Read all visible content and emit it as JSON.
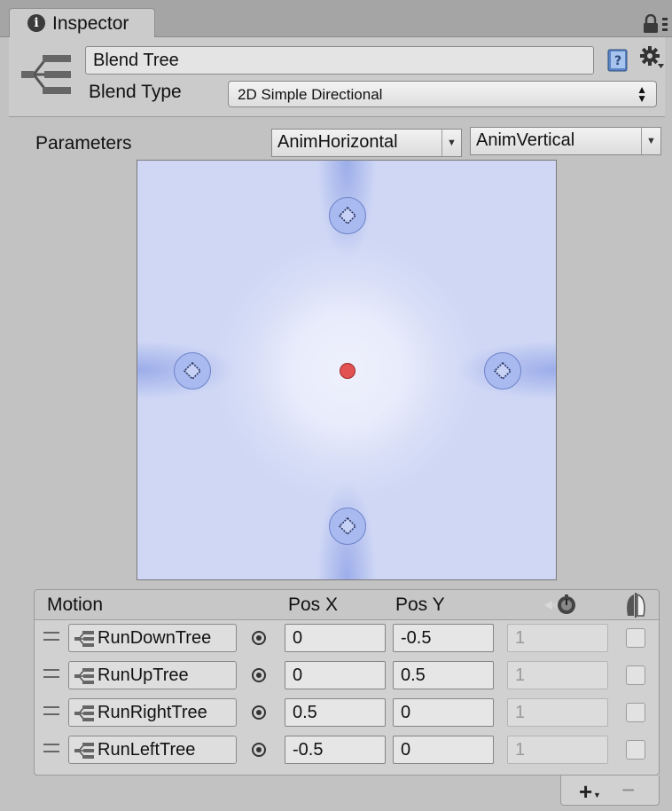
{
  "tab": {
    "label": "Inspector",
    "info_glyph": "i"
  },
  "header": {
    "name": "Blend Tree",
    "blend_type_label": "Blend Type",
    "blend_type_value": "2D Simple Directional"
  },
  "parameters": {
    "label": "Parameters",
    "x_param": "AnimHorizontal",
    "y_param": "AnimVertical"
  },
  "icons": {
    "tab": "info-icon",
    "lock": "lock-icon",
    "menu": "tab-menu-icon",
    "header": "blend-tree-icon",
    "help": "help-book-icon",
    "settings": "gear-icon",
    "speed_column": "speed-icon",
    "mirror_column": "mirror-icon"
  },
  "colors": {
    "graph_background": "#cfd7f5",
    "motion_point": "#a9baf0",
    "blend_marker": "#e25252"
  },
  "graph": {
    "range": [
      -0.5,
      0.5
    ],
    "current": {
      "x": 0,
      "y": 0
    }
  },
  "motion_list": {
    "headers": {
      "motion": "Motion",
      "pos_x": "Pos X",
      "pos_y": "Pos Y"
    },
    "rows": [
      {
        "motion": "RunDownTree",
        "pos_x": "0",
        "pos_y": "-0.5",
        "speed": "1",
        "mirror": false
      },
      {
        "motion": "RunUpTree",
        "pos_x": "0",
        "pos_y": "0.5",
        "speed": "1",
        "mirror": false
      },
      {
        "motion": "RunRightTree",
        "pos_x": "0.5",
        "pos_y": "0",
        "speed": "1",
        "mirror": false
      },
      {
        "motion": "RunLeftTree",
        "pos_x": "-0.5",
        "pos_y": "0",
        "speed": "1",
        "mirror": false
      }
    ],
    "footer": {
      "add": "+",
      "remove": "−"
    }
  }
}
